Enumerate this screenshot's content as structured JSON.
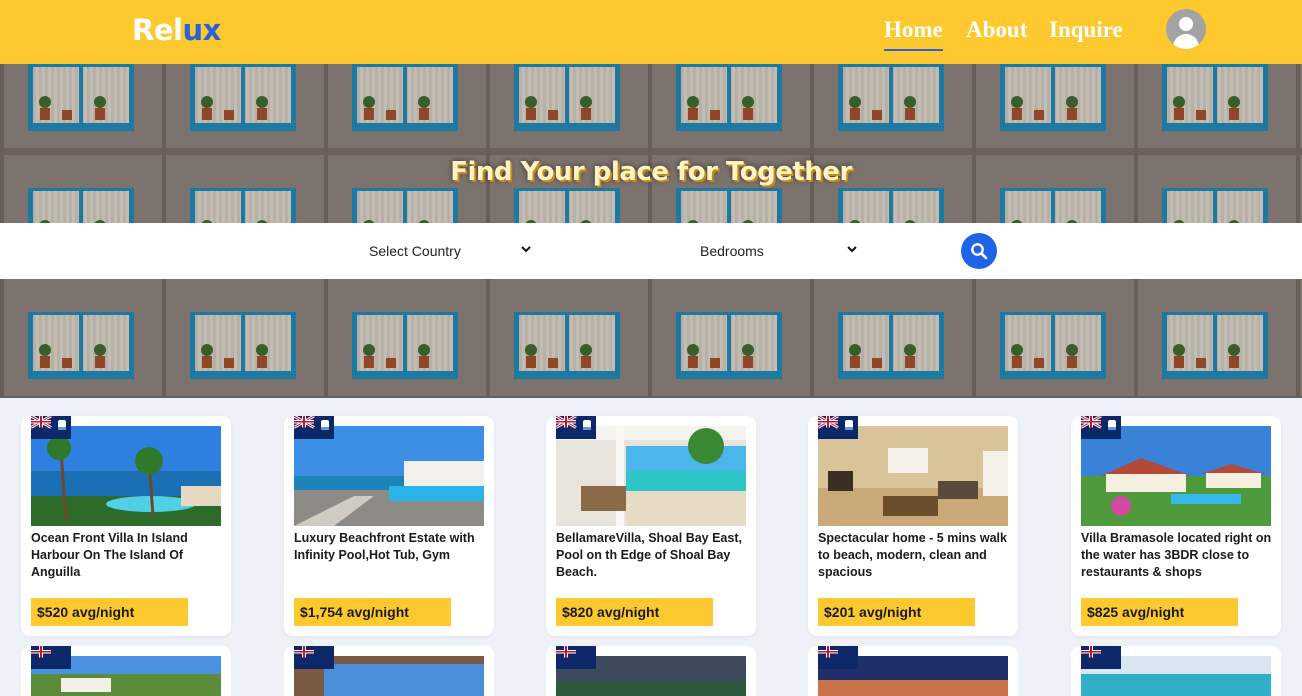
{
  "brand": {
    "part1": "Rel",
    "part2": "ux"
  },
  "nav": {
    "home": "Home",
    "about": "About",
    "inquire": "Inquire"
  },
  "hero": {
    "title": "Find Your place for Together"
  },
  "search": {
    "country": "Select Country",
    "bedrooms": "Bedrooms"
  },
  "colors": {
    "accent": "#fdc92f",
    "primary": "#1f63e8",
    "brand_blue": "#2a62d8"
  },
  "listings": [
    {
      "title": "Ocean Front Villa In Island Harbour On The Island Of Anguilla",
      "price": "$520 avg/night"
    },
    {
      "title": "Luxury Beachfront Estate with Infinity Pool,Hot Tub, Gym",
      "price": "$1,754 avg/night"
    },
    {
      "title": "BellamareVilla, Shoal Bay East, Pool on th Edge of Shoal Bay Beach.",
      "price": "$820 avg/night"
    },
    {
      "title": "Spectacular home - 5 mins walk to beach, modern, clean and spacious",
      "price": "$201 avg/night"
    },
    {
      "title": "Villa Bramasole located right on the water has 3BDR close to restaurants & shops",
      "price": "$825 avg/night"
    }
  ]
}
